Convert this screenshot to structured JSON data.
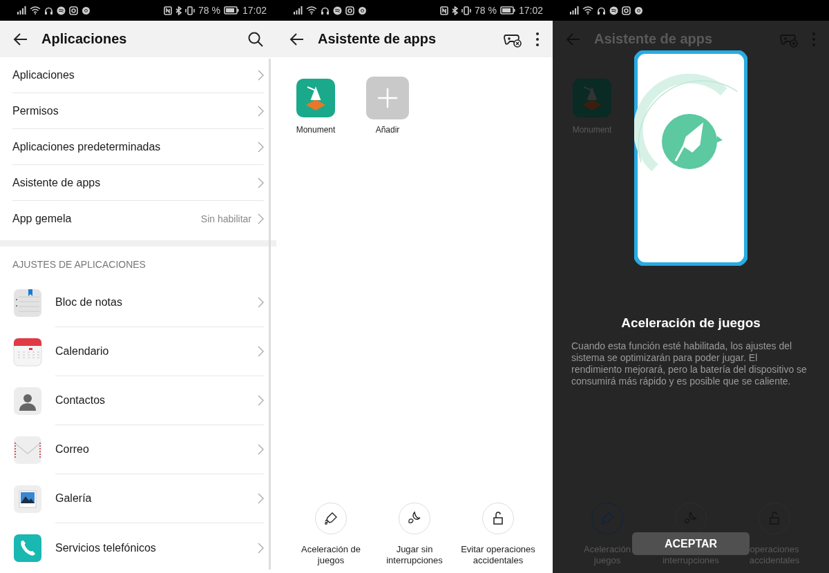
{
  "settings_screen": {
    "status_bar": {
      "battery": "78 %",
      "time": "17:02"
    },
    "title": "Aplicaciones",
    "menu_items": [
      {
        "label": "Aplicaciones"
      },
      {
        "label": "Permisos"
      },
      {
        "label": "Aplicaciones predeterminadas"
      },
      {
        "label": "Asistente de apps"
      },
      {
        "label": "App gemela",
        "value": "Sin habilitar"
      }
    ],
    "section_header": "AJUSTES DE APLICACIONES",
    "app_items": [
      {
        "label": "Bloc de notas"
      },
      {
        "label": "Calendario"
      },
      {
        "label": "Contactos"
      },
      {
        "label": "Correo"
      },
      {
        "label": "Galería"
      },
      {
        "label": "Servicios telefónicos"
      }
    ]
  },
  "assistant_screen": {
    "status_bar": {
      "battery": "78 %",
      "time": "17:02"
    },
    "title": "Asistente de apps",
    "apps": [
      {
        "label": "Monument",
        "kind": "app"
      },
      {
        "label": "Añadir",
        "kind": "add"
      }
    ],
    "features": [
      {
        "label": "Aceleración de juegos"
      },
      {
        "label": "Jugar sin interrupciones"
      },
      {
        "label": "Evitar operaciones accidentales"
      }
    ]
  },
  "dialog_screen": {
    "title": "Asistente de apps",
    "apps": [
      {
        "label": "Monument",
        "kind": "app"
      }
    ],
    "features": [
      {
        "lines": [
          "Aceleración",
          "juegos"
        ],
        "highlighted": true
      },
      {
        "lines": [
          "interrupciones"
        ],
        "highlighted": false
      },
      {
        "lines": [
          "operaciones",
          "accidentales"
        ],
        "highlighted": false
      }
    ],
    "dialog": {
      "title": "Aceleración de juegos",
      "body": "Cuando esta función esté habilitada, los ajustes del sistema se optimizarán para poder jugar. El rendimiento mejorará, pero la batería del dispositivo se consumirá más rápido y es posible que se caliente.",
      "button": "ACEPTAR"
    }
  }
}
